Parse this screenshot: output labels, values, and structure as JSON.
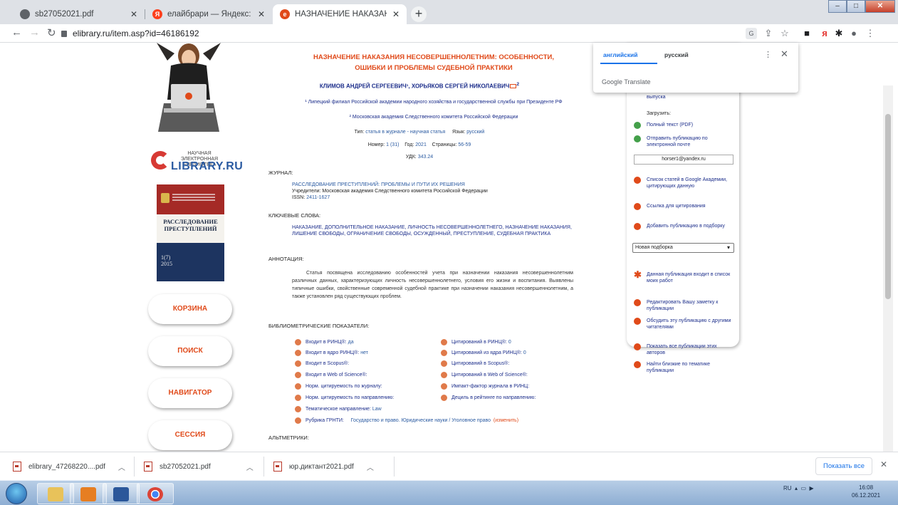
{
  "browser": {
    "tabs": [
      {
        "label": "sb27052021.pdf",
        "fav_color": "#5f6368"
      },
      {
        "label": "елайбрари — Яндекс: нашлось",
        "fav_color": "#fc3f1d"
      },
      {
        "label": "НАЗНАЧЕНИЕ НАКАЗАНИЯ НЕС",
        "fav_color": "#e04a1a"
      }
    ],
    "url": "elibrary.ru/item.asp?id=46186192"
  },
  "translate": {
    "tab_en": "английский",
    "tab_ru": "русский",
    "brand": "Google Translate"
  },
  "left": {
    "logo_line1": "НАУЧНАЯ ЭЛЕКТРОННАЯ",
    "logo_line2": "БИБЛИОТЕКА",
    "logo_main": "LIBRARY.RU",
    "cover_title": "РАССЛЕДОВАНИЕ ПРЕСТУПЛЕНИЙ",
    "cover_issue": "1(7)",
    "cover_year": "2015",
    "buttons": [
      "КОРЗИНА",
      "ПОИСК",
      "НАВИГАТОР",
      "СЕССИЯ"
    ]
  },
  "article": {
    "title": "НАЗНАЧЕНИЕ НАКАЗАНИЯ НЕСОВЕРШЕННОЛЕТНИМ: ОСОБЕННОСТИ, ОШИБКИ И ПРОБЛЕМЫ СУДЕБНОЙ ПРАКТИКИ",
    "authors": "КЛИМОВ АНДРЕЙ СЕРГЕЕВИЧ¹, ХОРЬЯКОВ СЕРГЕЙ НИКОЛАЕВИЧ",
    "author_sup": "2",
    "aff1": "¹ Липецкий филиал Российской академии народного хозяйства и государственной службы при Президенте РФ",
    "aff2": "² Московская академия Следственного комитета Российской Федерации",
    "type_label": "Тип:",
    "type_value": "статья в журнале - научная статья",
    "lang_label": "Язык:",
    "lang_value": "русский",
    "number_label": "Номер:",
    "number_value": "1 (31)",
    "year_label": "Год:",
    "year_value": "2021",
    "pages_label": "Страницы:",
    "pages_value": "56-59",
    "udk_label": "УДК:",
    "udk_value": "343.24",
    "journal_heading": "ЖУРНАЛ:",
    "journal_name": "РАССЛЕДОВАНИЕ ПРЕСТУПЛЕНИЙ: ПРОБЛЕМЫ И ПУТИ ИХ РЕШЕНИЯ",
    "journal_founders": "Учредители: Московская академия Следственного комитета Российской Федерации",
    "issn_label": "ISSN:",
    "issn_value": "2411-1627",
    "keywords_heading": "КЛЮЧЕВЫЕ СЛОВА:",
    "keywords": "НАКАЗАНИЕ, ДОПОЛНИТЕЛЬНОЕ НАКАЗАНИЕ, ЛИЧНОСТЬ НЕСОВЕРШЕННОЛЕТНЕГО, НАЗНАЧЕНИЕ НАКАЗАНИЯ, ЛИШЕНИЕ СВОБОДЫ, ОГРАНИЧЕНИЕ СВОБОДЫ, ОСУЖДЕННЫЙ, ПРЕСТУПЛЕНИЕ, СУДЕБНАЯ ПРАКТИКА",
    "abstract_heading": "АННОТАЦИЯ:",
    "abstract": "Статья посвящена исследованию особенностей учета при назначении наказания несовершеннолетним различных данных, характеризующих личность несовершеннолетнего, условия его жизни и воспитания. Выявлены типичные ошибки, свойственные современной судебной практике при назначении наказания несовершеннолетним, а также установлен ряд существующих проблем.",
    "bib_heading": "БИБЛИОМЕТРИЧЕСКИЕ ПОКАЗАТЕЛИ:",
    "altmetrics_heading": "АЛЬТМЕТРИКИ:"
  },
  "metrics": {
    "left": [
      {
        "label": "Входит в РИНЦ®:",
        "value": "да"
      },
      {
        "label": "Входит в ядро РИНЦ®:",
        "value": "нет"
      },
      {
        "label": "Входит в Scopus®:",
        "value": ""
      },
      {
        "label": "Входит в Web of Science®:",
        "value": ""
      },
      {
        "label": "Норм. цитируемость по журналу:",
        "value": ""
      },
      {
        "label": "Норм. цитируемость по направлению:",
        "value": ""
      },
      {
        "label": "Тематическое направление:",
        "value": "Law"
      }
    ],
    "right": [
      {
        "label": "Цитирований в РИНЦ®:",
        "value": "0"
      },
      {
        "label": "Цитирований из ядра РИНЦ®:",
        "value": "0"
      },
      {
        "label": "Цитирований в Scopus®:",
        "value": ""
      },
      {
        "label": "Цитирований в Web of Science®:",
        "value": ""
      },
      {
        "label": "Импакт-фактор журнала в РИНЦ:",
        "value": ""
      },
      {
        "label": "Дециль в рейтинге по направлению:",
        "value": ""
      }
    ],
    "grnti_label": "Рубрика ГРНТИ:",
    "grnti_value": "Государство и право. Юридические науки / Уголовное право",
    "grnti_change": "(изменить)"
  },
  "right_panel": {
    "release": "выпуска",
    "download": "Загрузить:",
    "fulltext": "Полный текст (PDF)",
    "send": "Отправить публикацию по электронной почте",
    "email": "horser1@yandex.ru",
    "scholar": "Список статей в Google Академии, цитирующих данную",
    "cite": "Ссылка для цитирования",
    "add": "Добавить публикацию в подборку",
    "select": "Новая подборка",
    "myworks": "Данная публикация входит в список моих работ",
    "edit_note": "Редактировать Вашу заметку к публикации",
    "discuss": "Обсудить эту публикацию с другими читателями",
    "show_all": "Показать все публикации этих авторов",
    "similar": "Найти близкие по тематике публикации"
  },
  "downloads": {
    "items": [
      "elibrary_47268220....pdf",
      "sb27052021.pdf",
      "юр.диктант2021.pdf"
    ],
    "show_all": "Показать все"
  },
  "taskbar": {
    "lang": "RU",
    "time": "16:08",
    "date": "06.12.2021"
  }
}
